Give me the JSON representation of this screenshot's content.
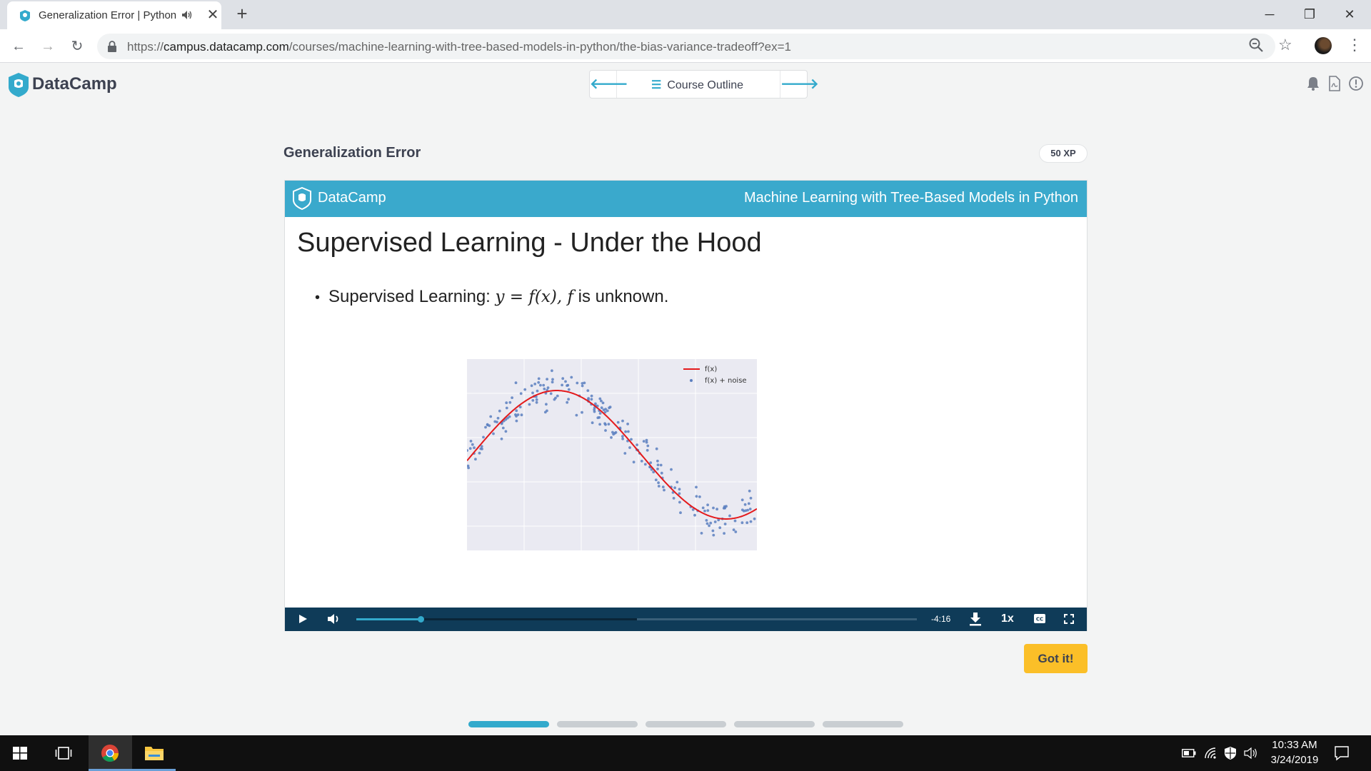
{
  "browser": {
    "tab_title": "Generalization Error | Python",
    "tab_close": "✕",
    "new_tab": "+",
    "url_scheme": "https://",
    "url_host": "campus.datacamp.com",
    "url_path": "/courses/machine-learning-with-tree-based-models-in-python/the-bias-variance-tradeoff?ex=1",
    "window_controls": {
      "minimize": "─",
      "restore": "❐",
      "close": "✕"
    },
    "nav": {
      "back": "←",
      "forward": "→",
      "reload": "↻"
    },
    "bookmark_icon": "☆",
    "menu_icon": "⋮"
  },
  "header": {
    "brand": "DataCamp",
    "course_outline": "Course Outline",
    "menu_glyph": "☰",
    "prev_arrow": "🡐",
    "next_arrow": "🡒"
  },
  "exercise": {
    "title": "Generalization Error",
    "xp": "50 XP",
    "got_it": "Got it!"
  },
  "slide": {
    "banner_brand": "DataCamp",
    "banner_course": "Machine Learning with Tree-Based Models in Python",
    "title": "Supervised Learning - Under the Hood",
    "bullet_prefix": "Supervised Learning: ",
    "bullet_math": "y = f(x), f",
    "bullet_suffix": " is unknown.",
    "legend": [
      "f(x)",
      "f(x) + noise"
    ]
  },
  "player": {
    "time_remaining": "-4:16",
    "speed": "1x",
    "progress_played": 0.115,
    "progress_buffered": 0.5
  },
  "lesson_progress": {
    "total": 5,
    "completed": 1
  },
  "taskbar": {
    "time": "10:33 AM",
    "date": "3/24/2019"
  },
  "colors": {
    "brand_blue": "#3aa9cc",
    "player_bg": "#0f3b58",
    "got_it_yellow": "#fbbf28",
    "curve_red": "#e41a1c",
    "noise_blue": "#5b7fbf"
  }
}
